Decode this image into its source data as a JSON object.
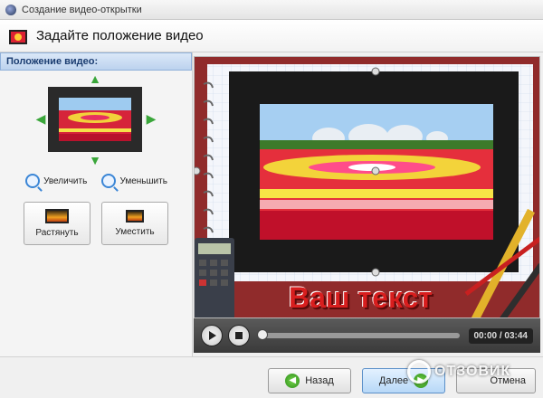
{
  "window": {
    "title": "Создание видео-открытки"
  },
  "header": {
    "title": "Задайте положение видео"
  },
  "left_panel": {
    "heading": "Положение видео:",
    "zoom_in_label": "Увеличить",
    "zoom_out_label": "Уменьшить",
    "stretch_label": "Растянуть",
    "fit_label": "Уместить"
  },
  "stage": {
    "overlay_text": "Ваш текст"
  },
  "player": {
    "time": "00:00 / 03:44",
    "progress": 0
  },
  "footer": {
    "back_label": "Назад",
    "next_label": "Далее",
    "cancel_label": "Отмена"
  },
  "watermark": {
    "text": "ОТЗОВИК"
  },
  "colors": {
    "accent": "#3b86d6",
    "overlay_text": "#d81e1e",
    "panel_header": "#bcd2ee"
  }
}
